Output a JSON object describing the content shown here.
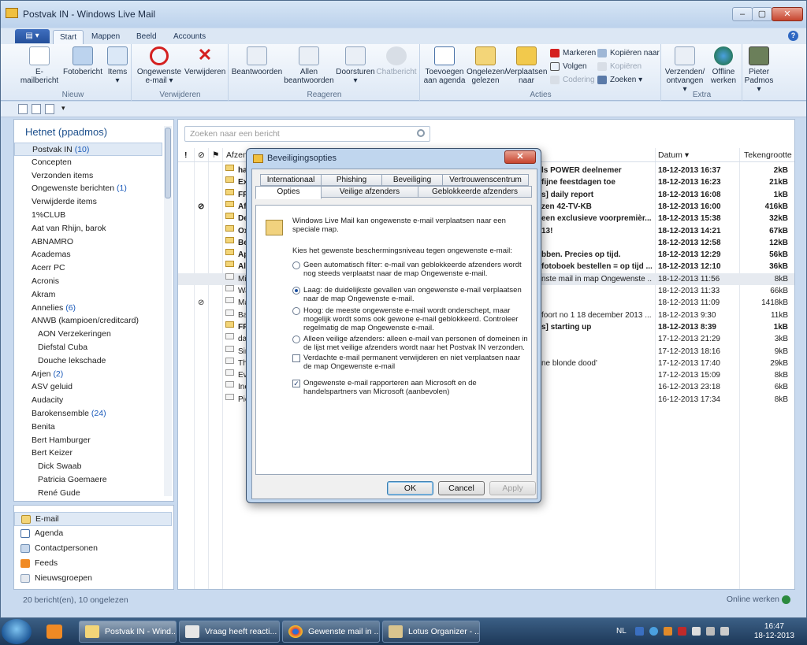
{
  "window": {
    "title": "Postvak IN - Windows Live Mail"
  },
  "ribbon_tabs": [
    "Start",
    "Mappen",
    "Beeld",
    "Accounts"
  ],
  "ribbon": {
    "groups": [
      {
        "label": "Nieuw",
        "buttons": [
          "E-mailbericht",
          "Fotobericht",
          "Items"
        ]
      },
      {
        "label": "Verwijderen",
        "buttons": [
          "Ongewenste e-mail",
          "Verwijderen"
        ]
      },
      {
        "label": "Reageren",
        "buttons": [
          "Beantwoorden",
          "Allen beantwoorden",
          "Doorsturen",
          "Chatbericht"
        ]
      },
      {
        "label": "Acties",
        "buttons": [
          "Toevoegen aan agenda",
          "Ongelezen/ gelezen",
          "Verplaatsen naar"
        ],
        "small": [
          "Markeren",
          "Volgen",
          "Codering",
          "Kopiëren naar",
          "Kopiëren",
          "Zoeken"
        ]
      },
      {
        "label": "Extra",
        "buttons": [
          "Verzenden/ ontvangen",
          "Offline werken"
        ]
      }
    ],
    "user": "Pieter Padmos"
  },
  "account": "Hetnet (ppadmos)",
  "folders": [
    {
      "name": "Postvak IN",
      "count": "(10)",
      "sub": false,
      "sel": true
    },
    {
      "name": "Concepten",
      "count": "",
      "sub": false
    },
    {
      "name": "Verzonden items",
      "count": "",
      "sub": false
    },
    {
      "name": "Ongewenste berichten",
      "count": "(1)",
      "sub": false
    },
    {
      "name": "Verwijderde items",
      "count": "",
      "sub": false
    },
    {
      "name": "1%CLUB",
      "count": "",
      "sub": false
    },
    {
      "name": "Aat van Rhijn, barok",
      "count": "",
      "sub": false
    },
    {
      "name": "ABNAMRO",
      "count": "",
      "sub": false
    },
    {
      "name": "Academas",
      "count": "",
      "sub": false
    },
    {
      "name": "Acerr PC",
      "count": "",
      "sub": false
    },
    {
      "name": "Acronis",
      "count": "",
      "sub": false
    },
    {
      "name": "Akram",
      "count": "",
      "sub": false
    },
    {
      "name": "Annelies",
      "count": "(6)",
      "sub": false
    },
    {
      "name": "ANWB (kampioen/creditcard)",
      "count": "",
      "sub": false
    },
    {
      "name": "AON Verzekeringen",
      "count": "",
      "sub": true
    },
    {
      "name": "Diefstal Cuba",
      "count": "",
      "sub": true,
      "deep": true
    },
    {
      "name": "Douche lekschade",
      "count": "",
      "sub": true,
      "deep": true
    },
    {
      "name": "Arjen",
      "count": "(2)",
      "sub": false
    },
    {
      "name": "ASV geluid",
      "count": "",
      "sub": false
    },
    {
      "name": "Audacity",
      "count": "",
      "sub": false
    },
    {
      "name": "Barokensemble",
      "count": "(24)",
      "sub": false
    },
    {
      "name": "Benita",
      "count": "",
      "sub": false
    },
    {
      "name": "Bert Hamburger",
      "count": "",
      "sub": false
    },
    {
      "name": "Bert Keizer",
      "count": "",
      "sub": false
    },
    {
      "name": "Dick Swaab",
      "count": "",
      "sub": true
    },
    {
      "name": "Patricia Goemaere",
      "count": "",
      "sub": true
    },
    {
      "name": "René Gude",
      "count": "",
      "sub": true
    }
  ],
  "nav": [
    "E-mail",
    "Agenda",
    "Contactpersonen",
    "Feeds",
    "Nieuwsgroepen"
  ],
  "search": {
    "placeholder": "Zoeken naar een bericht"
  },
  "columns": {
    "icons": [
      "!",
      "⊘",
      "⚑"
    ],
    "from": "Afzen",
    "date": "Datum",
    "size": "Tekengrootte"
  },
  "messages": [
    {
      "from": "ha",
      "subject": "ls POWER deelnemer",
      "date": "18-12-2013 16:37",
      "size": "2kB",
      "bold": true,
      "att": false
    },
    {
      "from": "Exp",
      "subject": "fijne feestdagen toe",
      "date": "18-12-2013 16:23",
      "size": "21kB",
      "bold": true,
      "att": false
    },
    {
      "from": "FPA",
      "subject": "s] daily report",
      "date": "18-12-2013 16:08",
      "size": "1kB",
      "bold": true,
      "att": false
    },
    {
      "from": "Afr",
      "subject": "zen 42-TV-KB",
      "date": "18-12-2013 16:00",
      "size": "416kB",
      "bold": true,
      "att": true
    },
    {
      "from": "De",
      "subject": "een exclusieve voorpremièr...",
      "date": "18-12-2013 15:38",
      "size": "32kB",
      "bold": true,
      "att": false
    },
    {
      "from": "Ox",
      "subject": "13!",
      "date": "18-12-2013 14:21",
      "size": "67kB",
      "bold": true,
      "att": false
    },
    {
      "from": "Be",
      "subject": "",
      "date": "18-12-2013 12:58",
      "size": "12kB",
      "bold": true,
      "att": false
    },
    {
      "from": "Ap",
      "subject": "bben. Precies op tijd.",
      "date": "18-12-2013 12:29",
      "size": "56kB",
      "bold": true,
      "att": false
    },
    {
      "from": "Alb",
      "subject": "fotoboek bestellen = op tijd ...",
      "date": "18-12-2013 12:10",
      "size": "36kB",
      "bold": true,
      "att": false
    },
    {
      "from": "Mi",
      "subject": "nste mail in map Ongewenste ...",
      "date": "18-12-2013 11:56",
      "size": "8kB",
      "bold": false,
      "att": false,
      "sel": true
    },
    {
      "from": "Wa",
      "subject": "",
      "date": "18-12-2013 11:33",
      "size": "66kB",
      "bold": false,
      "att": false
    },
    {
      "from": "Ma",
      "subject": "",
      "date": "18-12-2013 11:09",
      "size": "1418kB",
      "bold": false,
      "att": true
    },
    {
      "from": "Ba",
      "subject": "foort no 1   18 december 2013 ...",
      "date": "18-12-2013 9:30",
      "size": "11kB",
      "bold": false,
      "att": false
    },
    {
      "from": "FPA",
      "subject": "s] starting up",
      "date": "18-12-2013 8:39",
      "size": "1kB",
      "bold": true,
      "att": false
    },
    {
      "from": "day",
      "subject": "",
      "date": "17-12-2013 21:29",
      "size": "3kB",
      "bold": false,
      "att": false
    },
    {
      "from": "Sin",
      "subject": "",
      "date": "17-12-2013 18:16",
      "size": "9kB",
      "bold": false,
      "att": false
    },
    {
      "from": "Th",
      "subject": "ne blonde dood'",
      "date": "17-12-2013 17:40",
      "size": "29kB",
      "bold": false,
      "att": false
    },
    {
      "from": "Eva",
      "subject": "",
      "date": "17-12-2013 15:09",
      "size": "8kB",
      "bold": false,
      "att": false
    },
    {
      "from": "Ine",
      "subject": "",
      "date": "16-12-2013 23:18",
      "size": "6kB",
      "bold": false,
      "att": false
    },
    {
      "from": "Pie",
      "subject": "",
      "date": "16-12-2013 17:34",
      "size": "8kB",
      "bold": false,
      "att": false
    }
  ],
  "status": {
    "left": "20 bericht(en), 10 ongelezen",
    "right": "Online werken"
  },
  "dialog": {
    "title": "Beveiligingsopties",
    "tabs_top": [
      "Internationaal",
      "Phishing",
      "Beveiliging",
      "Vertrouwenscentrum"
    ],
    "tabs_bottom": [
      "Opties",
      "Veilige afzenders",
      "Geblokkeerde afzenders"
    ],
    "intro": "Windows Live Mail kan ongewenste e-mail verplaatsen naar een speciale map.",
    "choose": "Kies het gewenste beschermingsniveau tegen ongewenste e-mail:",
    "options": [
      {
        "text": "Geen automatisch filter: e-mail van geblokkeerde afzenders wordt nog steeds verplaatst naar de map Ongewenste e-mail.",
        "on": false
      },
      {
        "text": "Laag: de duidelijkste gevallen van ongewenste e-mail verplaatsen naar de map Ongewenste e-mail.",
        "on": true
      },
      {
        "text": "Hoog: de meeste ongewenste e-mail wordt onderschept, maar mogelijk wordt soms ook gewone e-mail geblokkeerd. Controleer regelmatig de map Ongewenste e-mail.",
        "on": false
      },
      {
        "text": "Alleen veilige afzenders: alleen e-mail van personen of domeinen in de lijst met veilige afzenders wordt naar het Postvak IN verzonden.",
        "on": false
      }
    ],
    "checks": [
      {
        "text": "Verdachte e-mail permanent verwijderen en niet verplaatsen naar de map Ongewenste e-mail",
        "on": false
      },
      {
        "text": "Ongewenste e-mail rapporteren aan Microsoft en de handelspartners van Microsoft (aanbevolen)",
        "on": true
      }
    ],
    "buttons": {
      "ok": "OK",
      "cancel": "Cancel",
      "apply": "Apply"
    }
  },
  "taskbar": {
    "tasks": [
      "Postvak IN - Wind...",
      "Vraag heeft reacti...",
      "Gewenste mail in ...",
      "Lotus Organizer - ..."
    ],
    "lang": "NL",
    "time": "16:47",
    "date": "18-12-2013"
  }
}
